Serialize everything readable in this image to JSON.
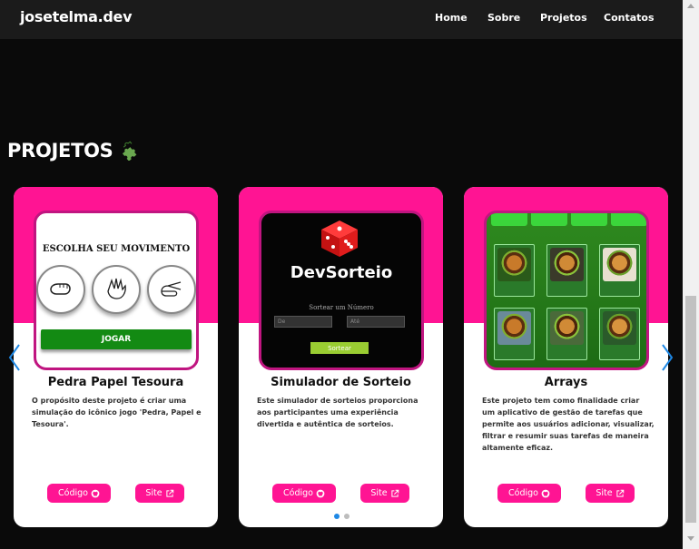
{
  "navbar": {
    "logo": "josetelma.dev",
    "items": [
      "Home",
      "Sobre",
      "Projetos",
      "Contatos"
    ]
  },
  "section": {
    "title": "PROJETOS",
    "icon": "puzzle-piece-icon"
  },
  "cards": [
    {
      "title": "Pedra Papel Tesoura",
      "description": "O propósito deste projeto é criar uma simulação do icônico jogo 'Pedra, Papel e Tesoura'.",
      "code_label": "Código",
      "site_label": "Site",
      "screenshot": {
        "heading": "ESCOLHA SEU MOVIMENTO",
        "button": "JOGAR"
      }
    },
    {
      "title": "Simulador de Sorteio",
      "description": "Este simulador de sorteios proporciona aos participantes uma experiência divertida e autêntica de sorteios.",
      "code_label": "Código",
      "site_label": "Site",
      "screenshot": {
        "logo": "DevSorteio",
        "subtitle": "Sortear um Número",
        "input_from": "De",
        "input_to": "Até",
        "button": "Sortear"
      }
    },
    {
      "title": "Arrays",
      "description": "Este projeto tem como finalidade criar um aplicativo de gestão de tarefas que permite aos usuários adicionar, visualizar, filtrar e resumir suas tarefas de maneira altamente eficaz.",
      "code_label": "Código",
      "site_label": "Site"
    }
  ],
  "carousel": {
    "pages": 2,
    "active_page": 1
  },
  "colors": {
    "accent": "#ff1493",
    "background": "#0a0a0a",
    "navbar": "#1b1b1b",
    "arrow": "#1e88e5"
  }
}
